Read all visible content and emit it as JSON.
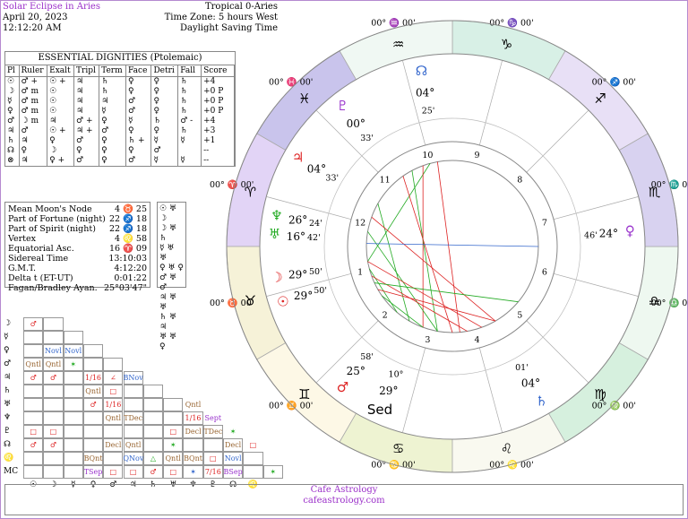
{
  "header": {
    "title": "Solar Eclipse in Aries",
    "date": "April 20, 2023",
    "time": "12:12:20 AM",
    "zodiac": "Tropical 0-Aries",
    "timezone": "Time Zone: 5 hours West",
    "dst": "Daylight Saving Time"
  },
  "dignities": {
    "title": "ESSENTIAL DIGNITIES  (Ptolemaic)",
    "columns": [
      "Pl",
      "Ruler",
      "Exalt",
      "Tripl",
      "Term",
      "Face",
      "Detri",
      "Fall",
      "Score"
    ],
    "rows": [
      [
        "☉",
        "♂ +",
        "☉ +",
        "♃",
        "♄",
        "♀",
        "♀",
        "♄",
        "+4"
      ],
      [
        "☽",
        "♂ m",
        "☉",
        "♃",
        "♄",
        "♀",
        "♀",
        "♄",
        "+0 P"
      ],
      [
        "☿",
        "♂ m",
        "☉",
        "♃",
        "♃",
        "♂",
        "♀",
        "♄",
        "+0 P"
      ],
      [
        "♀",
        "♂ m",
        "☉",
        "♃",
        "☿",
        "♂",
        "♀",
        "♄",
        "+0 P"
      ],
      [
        "♂",
        "☽ m",
        "♃",
        "♂ +",
        "♀",
        "☿",
        "♄",
        "♂ -",
        "+4"
      ],
      [
        "♃",
        "♂",
        "☉ +",
        "♃ +",
        "♂",
        "♀",
        "♀",
        "♄",
        "+3"
      ],
      [
        "♄",
        "♃",
        "♀",
        "♂",
        "♀",
        "♄ +",
        "☿",
        "☿",
        "+1"
      ],
      [
        "☊",
        "♀",
        "☽",
        "♀",
        "♀",
        "♀",
        "♂",
        "",
        "--"
      ],
      [
        "⊗",
        "♃",
        "♀ +",
        "♂",
        "♀",
        "♂",
        "☿",
        "☿",
        "--"
      ]
    ]
  },
  "points": [
    {
      "label": "Mean Moon's Node",
      "value": "4 ♉ 25"
    },
    {
      "label": "Part of Fortune (night)",
      "value": "22 ♐ 18"
    },
    {
      "label": "Part of Spirit (night)",
      "value": "22 ♐ 18"
    },
    {
      "label": "Vertex",
      "value": "4 ♌ 58"
    },
    {
      "label": "Equatorial Asc.",
      "value": "16 ♈ 09"
    },
    {
      "label": "Sidereal Time",
      "value": "13:10:03"
    },
    {
      "label": "G.M.T.",
      "value": "4:12:20"
    },
    {
      "label": "Delta t (ET-UT)",
      "value": "0:01:22"
    },
    {
      "label": "Fagan/Bradley Ayan.",
      "value": "25°03'47\""
    }
  ],
  "legend": [
    "☉ ♅ ☽",
    "☽ ♅ ♄",
    "☿ ♅ ♅",
    "♀ ♅ ♀",
    "♂ ♅ ♂",
    "♃ ♅ ♅",
    "♄ ♅ ♃",
    "♅ ♅ ♀"
  ],
  "aspect_grid": {
    "row_labels": [
      "☽",
      "☿",
      "♀",
      "♂",
      "♃",
      "♄",
      "♅",
      "♆",
      "♇",
      "☊",
      "♌",
      "MC"
    ],
    "col_labels": [
      "☉",
      "☽",
      "☿",
      "♀",
      "♂",
      "♃",
      "♄",
      "♅",
      "♆",
      "♇",
      "☊",
      "♌"
    ],
    "cells": [
      {
        "r": 0,
        "c": 0,
        "t": "♂",
        "col": "#d22"
      },
      {
        "r": 2,
        "c": 1,
        "t": "Novl",
        "col": "#36c"
      },
      {
        "r": 2,
        "c": 2,
        "t": "Novl",
        "col": "#36c"
      },
      {
        "r": 3,
        "c": 0,
        "t": "Qntl",
        "col": "#963"
      },
      {
        "r": 3,
        "c": 1,
        "t": "Qntl",
        "col": "#963"
      },
      {
        "r": 3,
        "c": 2,
        "t": "✶",
        "col": "#2a2"
      },
      {
        "r": 4,
        "c": 0,
        "t": "♂",
        "col": "#d22"
      },
      {
        "r": 4,
        "c": 1,
        "t": "♂",
        "col": "#d22"
      },
      {
        "r": 4,
        "c": 3,
        "t": "1/16",
        "col": "#d22"
      },
      {
        "r": 4,
        "c": 4,
        "t": "∠",
        "col": "#d22"
      },
      {
        "r": 4,
        "c": 5,
        "t": "BNov",
        "col": "#36c"
      },
      {
        "r": 5,
        "c": 3,
        "t": "Qntl",
        "col": "#963"
      },
      {
        "r": 5,
        "c": 4,
        "t": "□",
        "col": "#d22"
      },
      {
        "r": 6,
        "c": 3,
        "t": "♂",
        "col": "#d22"
      },
      {
        "r": 6,
        "c": 4,
        "t": "1/16",
        "col": "#d22"
      },
      {
        "r": 6,
        "c": 8,
        "t": "Qntl",
        "col": "#963"
      },
      {
        "r": 7,
        "c": 4,
        "t": "Qntl",
        "col": "#963"
      },
      {
        "r": 7,
        "c": 5,
        "t": "TDec",
        "col": "#963"
      },
      {
        "r": 7,
        "c": 8,
        "t": "1/16",
        "col": "#d22"
      },
      {
        "r": 7,
        "c": 9,
        "t": "Sept",
        "col": "#93c"
      },
      {
        "r": 8,
        "c": 0,
        "t": "□",
        "col": "#d22"
      },
      {
        "r": 8,
        "c": 1,
        "t": "□",
        "col": "#d22"
      },
      {
        "r": 8,
        "c": 7,
        "t": "□",
        "col": "#d22"
      },
      {
        "r": 8,
        "c": 8,
        "t": "Decl",
        "col": "#963"
      },
      {
        "r": 8,
        "c": 9,
        "t": "TDec",
        "col": "#963"
      },
      {
        "r": 8,
        "c": 10,
        "t": "✶",
        "col": "#2a2"
      },
      {
        "r": 9,
        "c": 0,
        "t": "♂",
        "col": "#d22"
      },
      {
        "r": 9,
        "c": 1,
        "t": "♂",
        "col": "#d22"
      },
      {
        "r": 9,
        "c": 4,
        "t": "Decl",
        "col": "#963"
      },
      {
        "r": 9,
        "c": 5,
        "t": "Qntl",
        "col": "#963"
      },
      {
        "r": 9,
        "c": 7,
        "t": "✶",
        "col": "#2a2"
      },
      {
        "r": 9,
        "c": 10,
        "t": "Decl",
        "col": "#963"
      },
      {
        "r": 9,
        "c": 11,
        "t": "□",
        "col": "#d22"
      },
      {
        "r": 10,
        "c": 3,
        "t": "BQnt",
        "col": "#963"
      },
      {
        "r": 10,
        "c": 5,
        "t": "QNov",
        "col": "#36c"
      },
      {
        "r": 10,
        "c": 6,
        "t": "△",
        "col": "#2a2"
      },
      {
        "r": 10,
        "c": 7,
        "t": "Qntl",
        "col": "#963"
      },
      {
        "r": 10,
        "c": 8,
        "t": "BQnt",
        "col": "#963"
      },
      {
        "r": 10,
        "c": 9,
        "t": "□",
        "col": "#d22"
      },
      {
        "r": 10,
        "c": 10,
        "t": "Novl",
        "col": "#36c"
      },
      {
        "r": 11,
        "c": 3,
        "t": "TSep",
        "col": "#93c"
      },
      {
        "r": 11,
        "c": 4,
        "t": "□",
        "col": "#d22"
      },
      {
        "r": 11,
        "c": 5,
        "t": "□",
        "col": "#d22"
      },
      {
        "r": 11,
        "c": 6,
        "t": "♂",
        "col": "#d22"
      },
      {
        "r": 11,
        "c": 7,
        "t": "□",
        "col": "#d22"
      },
      {
        "r": 11,
        "c": 8,
        "t": "✶",
        "col": "#36c"
      },
      {
        "r": 11,
        "c": 9,
        "t": "7/16",
        "col": "#d22"
      },
      {
        "r": 11,
        "c": 10,
        "t": "BSep",
        "col": "#93c"
      },
      {
        "r": 11,
        "c": 12,
        "t": "✶",
        "col": "#2a2"
      }
    ]
  },
  "wheel": {
    "signs": [
      {
        "glyph": "♑",
        "color": "#d8f0e6"
      },
      {
        "glyph": "♒",
        "color": "#f0f8f3"
      },
      {
        "glyph": "♓",
        "color": "#c9c4ec"
      },
      {
        "glyph": "♈",
        "color": "#e2d4f6"
      },
      {
        "glyph": "♉",
        "color": "#f6f2d8"
      },
      {
        "glyph": "♊",
        "color": "#fdf8e6"
      },
      {
        "glyph": "♋",
        "color": "#eef3d2"
      },
      {
        "glyph": "♌",
        "color": "#f9f9f0"
      },
      {
        "glyph": "♍",
        "color": "#d6f0de"
      },
      {
        "glyph": "♎",
        "color": "#eef8f0"
      },
      {
        "glyph": "♏",
        "color": "#d8d2f0"
      },
      {
        "glyph": "♐",
        "color": "#e8e0f6"
      }
    ],
    "cusp_labels": [
      "00° ♑ 00'",
      "00° ♒ 00'",
      "00° ♓ 00'",
      "00° ♈ 00'",
      "00° ♉ 00'",
      "00° ♊ 00'",
      "00° ♋ 00'",
      "00° ♌ 00'",
      "00° ♍ 00'",
      "00° ♎ 00'",
      "00° ♏ 00'",
      "00° ♐ 00'"
    ],
    "houses": [
      "1",
      "2",
      "3",
      "4",
      "5",
      "6",
      "7",
      "8",
      "9",
      "10",
      "11",
      "12"
    ],
    "planet_labels": [
      {
        "g": "♇",
        "deg": "00°",
        "min": "33'",
        "col": "#93c"
      },
      {
        "g": "♃",
        "deg": "04°",
        "min": "33'",
        "col": "#d22"
      },
      {
        "g": "♆",
        "deg": "26°",
        "min": "24'",
        "col": "#2a2"
      },
      {
        "g": "♅",
        "deg": "16°",
        "min": "42'",
        "col": "#2a2"
      },
      {
        "g": "☽",
        "deg": "29°",
        "min": "50'",
        "col": "#d22"
      },
      {
        "g": "☉",
        "deg": "29°",
        "min": "50'",
        "col": "#d22"
      },
      {
        "g": "☊",
        "deg": "04°",
        "min": "25'",
        "col": "#36c"
      },
      {
        "g": "♀",
        "deg": "24°",
        "min": "46'",
        "col": "#93c"
      },
      {
        "g": "♂",
        "deg": "25°",
        "min": "58'",
        "col": "#d22"
      },
      {
        "g": "♄",
        "deg": "04°",
        "min": "01'",
        "col": "#36c"
      },
      {
        "g": "Sed",
        "deg": "29°",
        "min": "10°",
        "col": "#000"
      }
    ]
  },
  "footer": {
    "line1": "Cafe Astrology",
    "line2": "cafeastrology.com"
  }
}
